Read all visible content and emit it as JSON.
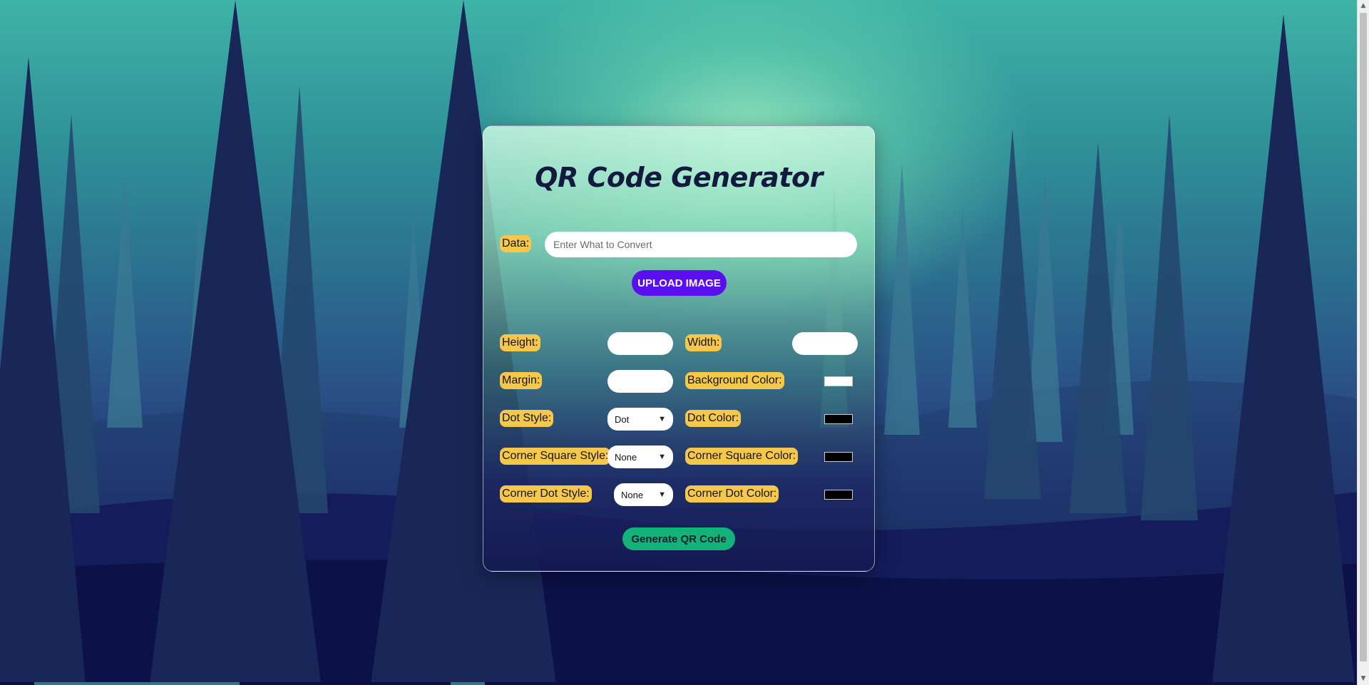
{
  "title": "QR Code Generator",
  "data_field": {
    "label": "Data:",
    "placeholder": "Enter What to Convert",
    "value": ""
  },
  "upload_button": "UPLOAD IMAGE",
  "fields": {
    "height": {
      "label": "Height:",
      "value": ""
    },
    "width": {
      "label": "Width:",
      "value": ""
    },
    "margin": {
      "label": "Margin:",
      "value": ""
    },
    "background_color": {
      "label": "Background Color:",
      "color": "#ffffff"
    },
    "dot_style": {
      "label": "Dot Style:",
      "selected": "Dot"
    },
    "dot_color": {
      "label": "Dot Color:",
      "color": "#000000"
    },
    "corner_square_style": {
      "label": "Corner Square Style:",
      "selected": "None"
    },
    "corner_square_color": {
      "label": "Corner Square Color:",
      "color": "#000000"
    },
    "corner_dot_style": {
      "label": "Corner Dot Style:",
      "selected": "None"
    },
    "corner_dot_color": {
      "label": "Corner Dot Color:",
      "color": "#000000"
    }
  },
  "generate_button": "Generate QR Code",
  "colors": {
    "label_bg": "#f5c74a",
    "upload_btn": "#5a0ff0",
    "generate_btn": "#12b278"
  },
  "icons": {
    "select_arrow": "chevron-down-icon"
  }
}
